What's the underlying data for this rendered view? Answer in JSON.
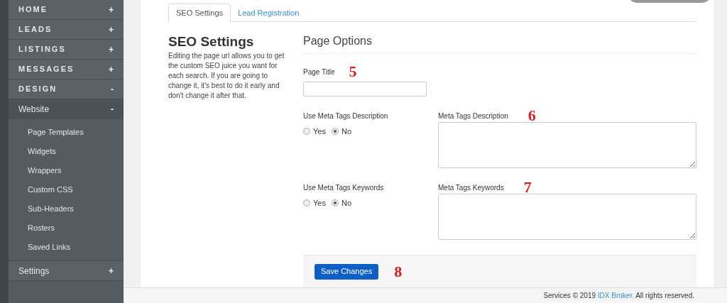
{
  "sidebar": {
    "items": [
      {
        "label": "HOME",
        "sign": "+",
        "active": false,
        "kind": "section"
      },
      {
        "label": "LEADS",
        "sign": "+",
        "active": false,
        "kind": "section"
      },
      {
        "label": "LISTINGS",
        "sign": "+",
        "active": false,
        "kind": "section"
      },
      {
        "label": "MESSAGES",
        "sign": "+",
        "active": false,
        "kind": "section"
      },
      {
        "label": "DESIGN",
        "sign": "-",
        "active": false,
        "kind": "section"
      },
      {
        "label": "Website",
        "sign": "-",
        "active": true,
        "kind": "group",
        "children": [
          {
            "label": "Page Templates"
          },
          {
            "label": "Widgets"
          },
          {
            "label": "Wrappers"
          },
          {
            "label": "Custom CSS"
          },
          {
            "label": "Sub-Headers"
          },
          {
            "label": "Rosters"
          },
          {
            "label": "Saved Links"
          }
        ]
      },
      {
        "label": "Settings",
        "sign": "+",
        "active": false,
        "kind": "group"
      }
    ]
  },
  "tabs": [
    {
      "label": "SEO Settings",
      "selected": true
    },
    {
      "label": "Lead Registration",
      "selected": false
    }
  ],
  "intro": {
    "title": "SEO Settings",
    "text": "Editing the page url allows you to get the custom SEO juice you want for each search. If you are going to change it, it's best to do it early and don't change it after that."
  },
  "page_options": {
    "title": "Page Options",
    "page_title": {
      "label": "Page Title",
      "marker": "5"
    },
    "meta_rows": [
      {
        "toggle_label": "Use Meta Tags Description",
        "options": [
          {
            "label": "Yes",
            "selected": false
          },
          {
            "label": "No",
            "selected": true
          }
        ],
        "field_label": "Meta Tags Description",
        "marker": "6"
      },
      {
        "toggle_label": "Use Meta Tags Keywords",
        "options": [
          {
            "label": "Yes",
            "selected": false
          },
          {
            "label": "No",
            "selected": true
          }
        ],
        "field_label": "Meta Tags Keywords",
        "marker": "7"
      }
    ],
    "save_button": "Save Changes",
    "save_marker": "8"
  },
  "footer": {
    "before": "Services © 2019 ",
    "link": "IDX Broker.",
    "after": " All rights reserved."
  }
}
